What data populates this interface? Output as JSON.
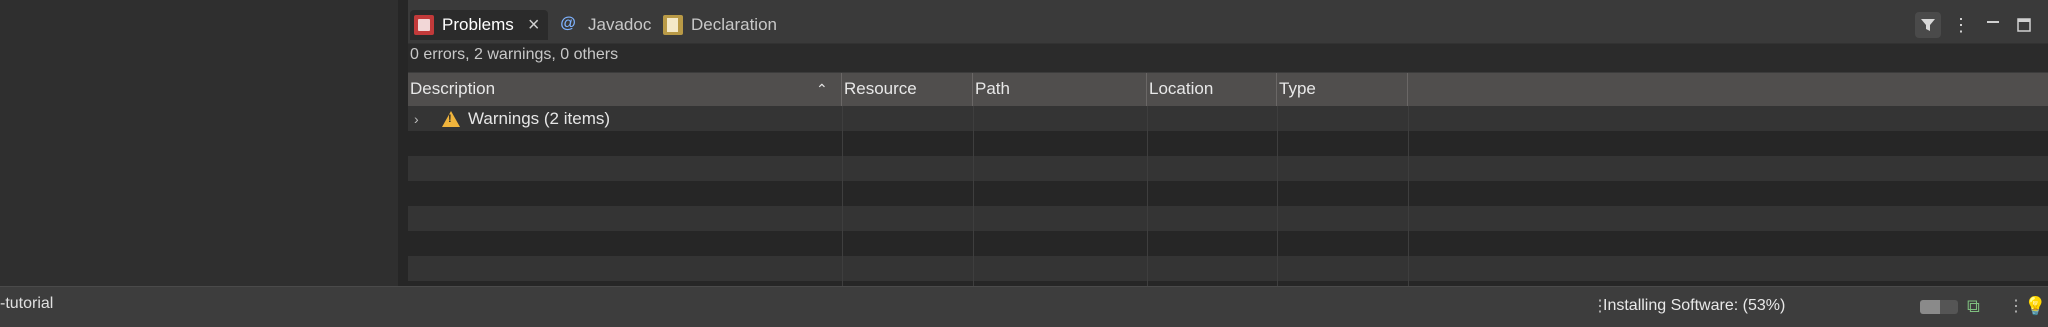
{
  "tabs": [
    {
      "label": "Problems",
      "icon": "problems-icon",
      "active": true
    },
    {
      "label": "Javadoc",
      "icon": "javadoc-icon"
    },
    {
      "label": "Declaration",
      "icon": "declaration-icon"
    }
  ],
  "summary": "0 errors, 2 warnings, 0 others",
  "columns": [
    "Description",
    "Resource",
    "Path",
    "Location",
    "Type"
  ],
  "rows": [
    {
      "label": "Warnings (2 items)",
      "icon": "warning-icon",
      "expanded": false
    }
  ],
  "status": {
    "left_text": "-tutorial",
    "progress_text": "Installing Software: (53%)",
    "progress_percent": 53
  },
  "colors": {
    "warning": "#f0b43c",
    "header_bg": "#504e4d"
  }
}
